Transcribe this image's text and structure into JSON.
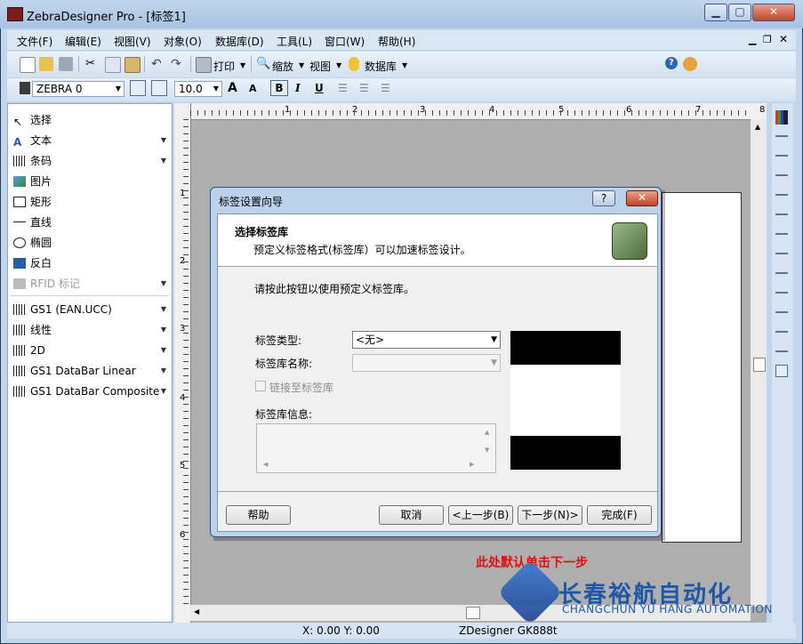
{
  "window": {
    "title": "ZebraDesigner Pro - [标签1]"
  },
  "menu": [
    "文件(F)",
    "编辑(E)",
    "视图(V)",
    "对象(O)",
    "数据库(D)",
    "工具(L)",
    "窗口(W)",
    "帮助(H)"
  ],
  "toolbar": {
    "print": "打印",
    "zoom": "缩放",
    "view": "视图",
    "database": "数据库"
  },
  "format_bar": {
    "printer": "ZEBRA 0",
    "font_size": "10.0"
  },
  "tools": [
    {
      "label": "选择",
      "icon": "pointer-icon"
    },
    {
      "label": "文本",
      "icon": "text-icon"
    },
    {
      "label": "条码",
      "icon": "barcode-icon"
    },
    {
      "label": "图片",
      "icon": "image-icon"
    },
    {
      "label": "矩形",
      "icon": "rectangle-icon"
    },
    {
      "label": "直线",
      "icon": "line-icon"
    },
    {
      "label": "椭圆",
      "icon": "ellipse-icon"
    },
    {
      "label": "反白",
      "icon": "inverse-icon"
    },
    {
      "label": "RFID 标记",
      "icon": "rfid-icon"
    },
    {
      "label": "GS1 (EAN.UCC)",
      "icon": "barcode-icon"
    },
    {
      "label": "线性",
      "icon": "barcode-icon"
    },
    {
      "label": "2D",
      "icon": "barcode-icon"
    },
    {
      "label": "GS1 DataBar Linear",
      "icon": "barcode-icon"
    },
    {
      "label": "GS1 DataBar Composite",
      "icon": "barcode-icon"
    }
  ],
  "ruler": {
    "top": [
      "1",
      "2",
      "3",
      "4",
      "5",
      "6",
      "7",
      "8"
    ],
    "left": [
      "1",
      "2",
      "3",
      "4",
      "5",
      "6"
    ]
  },
  "dialog": {
    "title": "标签设置向导",
    "heading": "选择标签库",
    "subheading": "预定义标签格式(标签库）可以加速标签设计。",
    "instruction": "请按此按钮以使用预定义标签库。",
    "label_type_label": "标签类型:",
    "label_type_value": "<无>",
    "library_name_label": "标签库名称:",
    "link_label": "链接至标签库",
    "library_info_label": "标签库信息:",
    "buttons": {
      "help": "帮助",
      "cancel": "取消",
      "back": "<上一步(B)",
      "next": "下一步(N)>",
      "finish": "完成(F)"
    }
  },
  "status": {
    "coords": "X:  0.00 Y:  0.00",
    "printer": "ZDesigner GK888t"
  },
  "annotation": "此处默认单击下一步",
  "watermark": {
    "company": "长春裕航自动化",
    "company_en": "CHANGCHUN YU HANG AUTOMATION"
  }
}
